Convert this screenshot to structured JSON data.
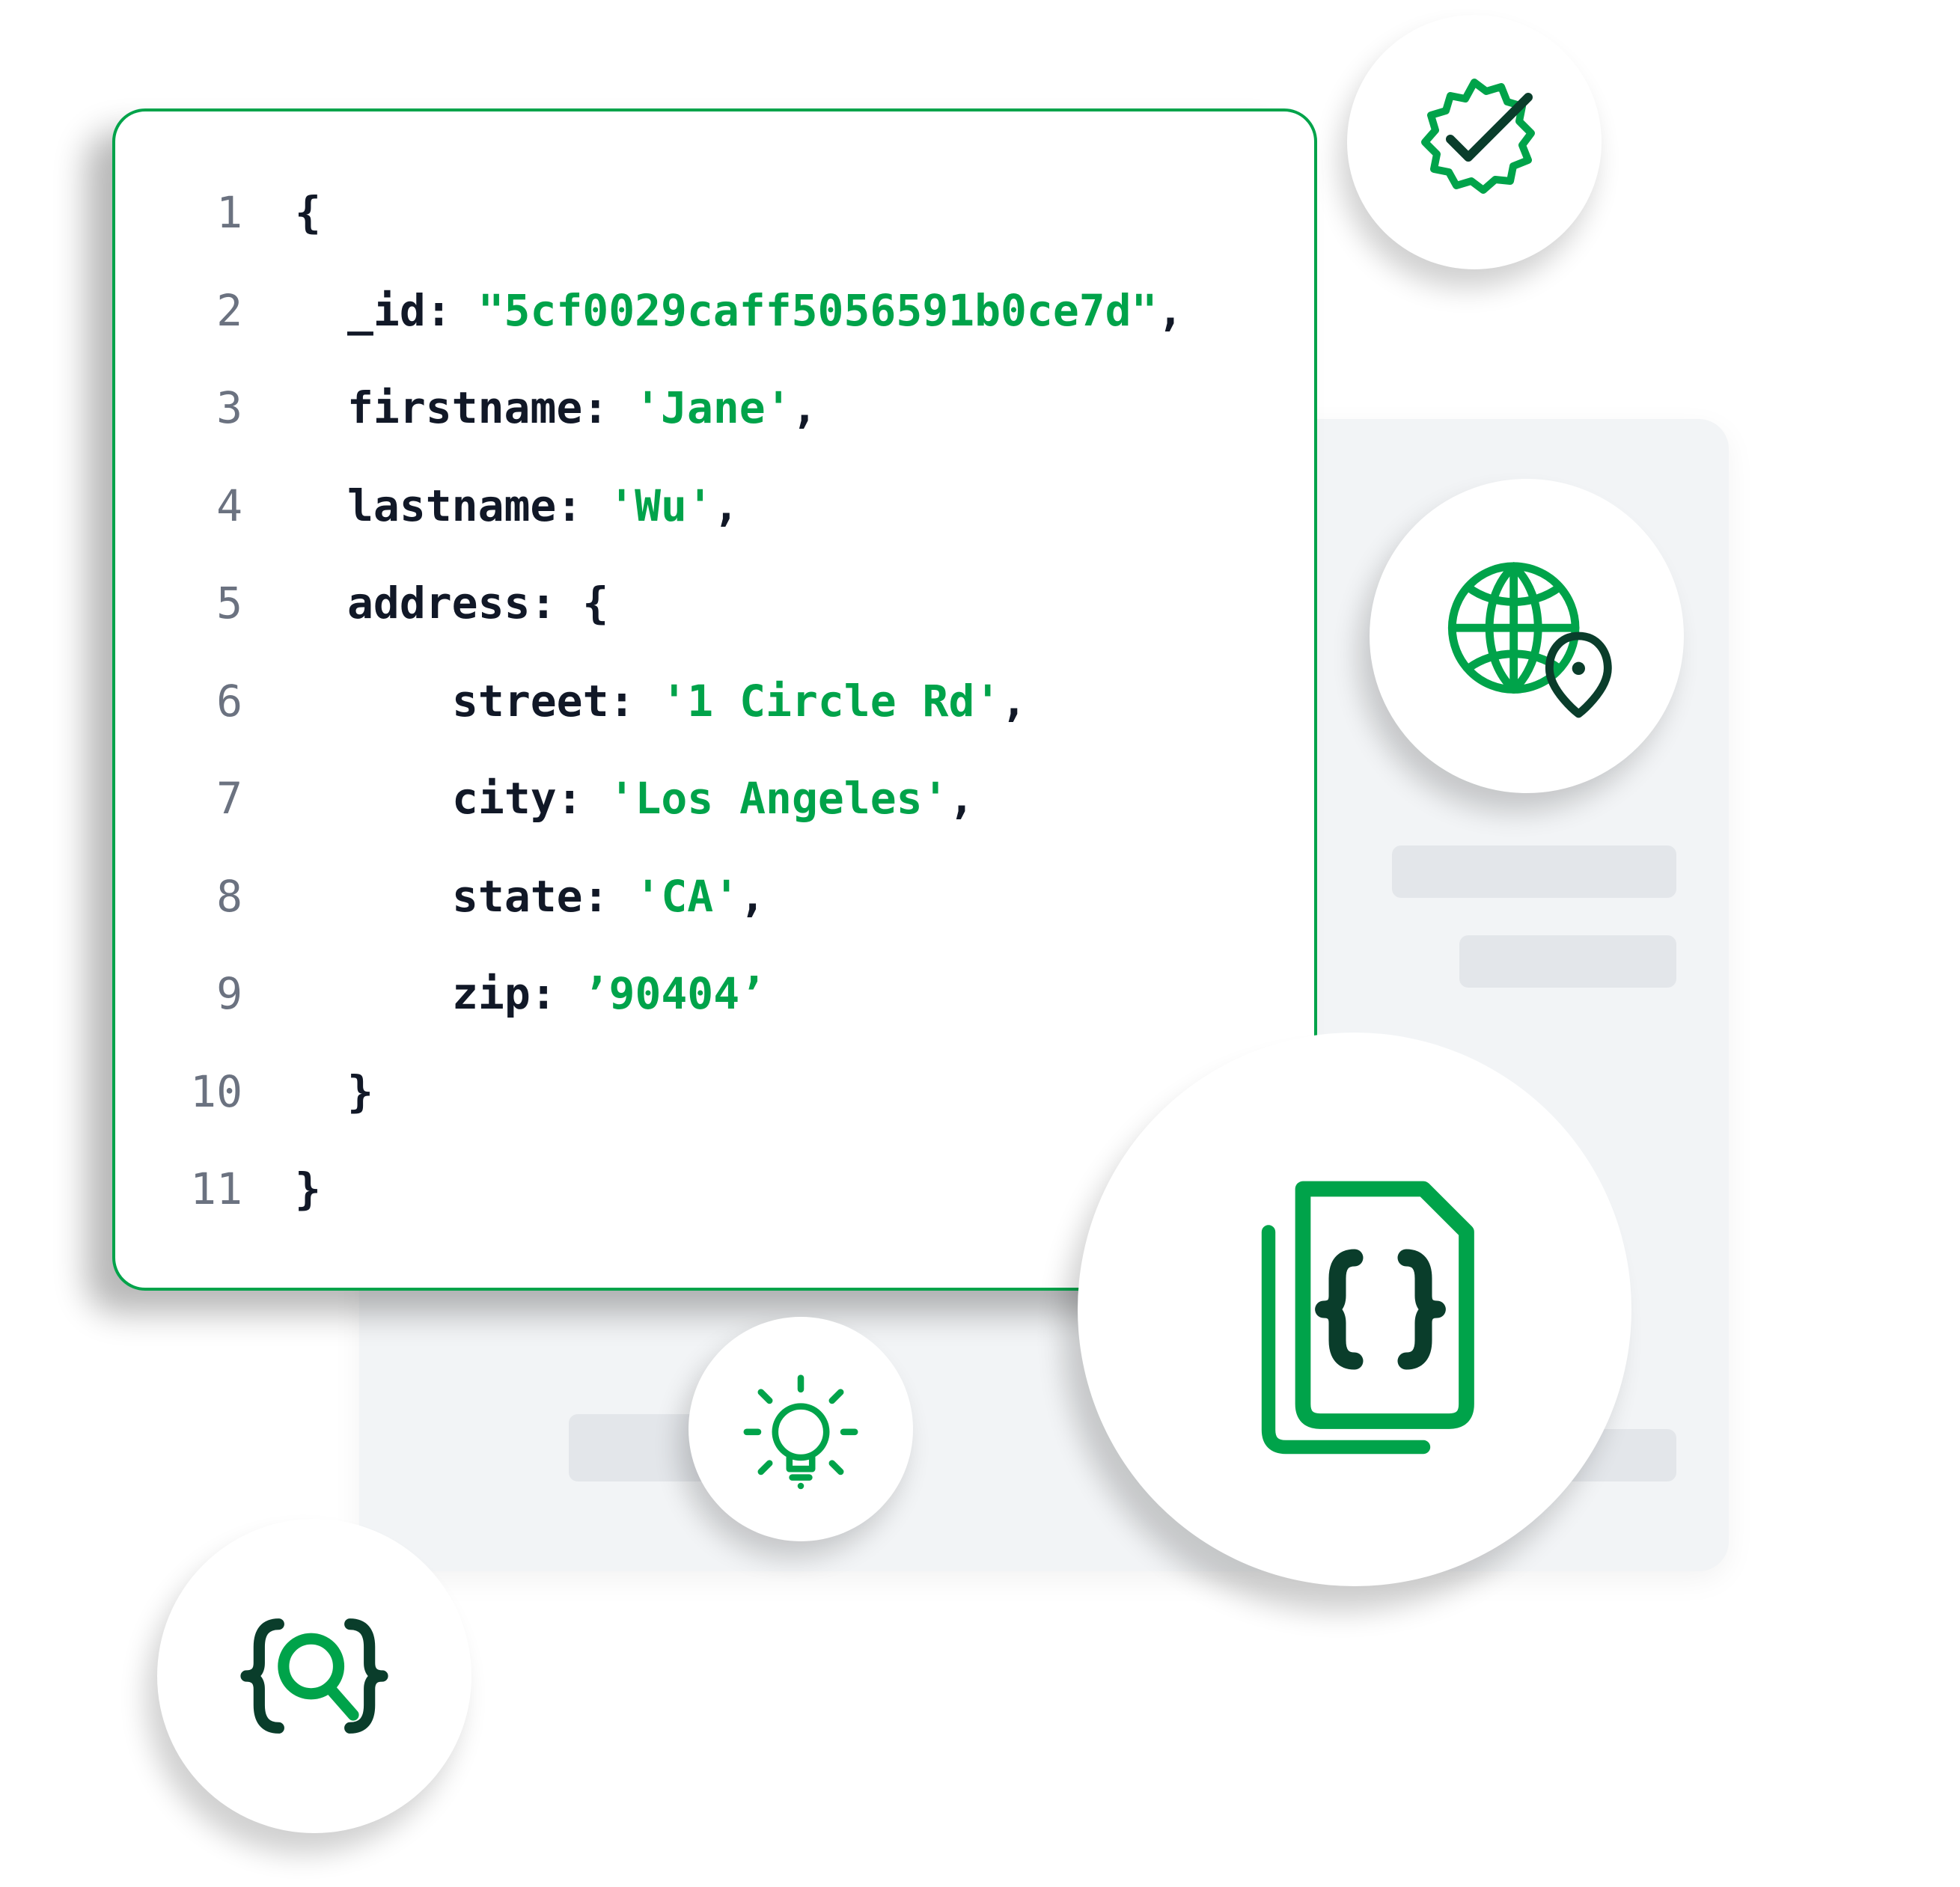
{
  "icons": {
    "check_badge": "verified-check-icon",
    "globe_pin": "globe-location-icon",
    "documents": "json-documents-icon",
    "lightbulb": "lightbulb-icon",
    "code_search": "code-search-icon"
  },
  "code": {
    "lines": [
      {
        "n": "1",
        "indent": 0,
        "segments": [
          {
            "t": "{",
            "c": "punct"
          }
        ]
      },
      {
        "n": "2",
        "indent": 1,
        "segments": [
          {
            "t": "_id",
            "c": "key"
          },
          {
            "t": ": ",
            "c": "punct"
          },
          {
            "t": "\"5cf0029caff5056591b0ce7d\"",
            "c": "dq"
          },
          {
            "t": ",",
            "c": "punct"
          }
        ]
      },
      {
        "n": "3",
        "indent": 1,
        "segments": [
          {
            "t": "firstname",
            "c": "key"
          },
          {
            "t": ": ",
            "c": "punct"
          },
          {
            "t": "'Jane'",
            "c": "str"
          },
          {
            "t": ",",
            "c": "punct"
          }
        ]
      },
      {
        "n": "4",
        "indent": 1,
        "segments": [
          {
            "t": "lastname",
            "c": "key"
          },
          {
            "t": ": ",
            "c": "punct"
          },
          {
            "t": "'Wu'",
            "c": "str"
          },
          {
            "t": ",",
            "c": "punct"
          }
        ]
      },
      {
        "n": "5",
        "indent": 1,
        "segments": [
          {
            "t": "address",
            "c": "key"
          },
          {
            "t": ": ",
            "c": "punct"
          },
          {
            "t": "{",
            "c": "punct"
          }
        ]
      },
      {
        "n": "6",
        "indent": 2,
        "segments": [
          {
            "t": "street",
            "c": "key"
          },
          {
            "t": ": ",
            "c": "punct"
          },
          {
            "t": "'1 Circle Rd'",
            "c": "str"
          },
          {
            "t": ",",
            "c": "punct"
          }
        ]
      },
      {
        "n": "7",
        "indent": 2,
        "segments": [
          {
            "t": "city",
            "c": "key"
          },
          {
            "t": ": ",
            "c": "punct"
          },
          {
            "t": "'Los Angeles'",
            "c": "str"
          },
          {
            "t": ",",
            "c": "punct"
          }
        ]
      },
      {
        "n": "8",
        "indent": 2,
        "segments": [
          {
            "t": "state",
            "c": "key"
          },
          {
            "t": ": ",
            "c": "punct"
          },
          {
            "t": "'CA'",
            "c": "str"
          },
          {
            "t": ",",
            "c": "punct"
          }
        ]
      },
      {
        "n": "9",
        "indent": 2,
        "segments": [
          {
            "t": "zip",
            "c": "key"
          },
          {
            "t": ": ",
            "c": "punct"
          },
          {
            "t": "’90404’",
            "c": "str"
          }
        ]
      },
      {
        "n": "10",
        "indent": 1,
        "segments": [
          {
            "t": "}",
            "c": "punct"
          }
        ]
      },
      {
        "n": "11",
        "indent": 0,
        "segments": [
          {
            "t": "}",
            "c": "punct"
          }
        ]
      }
    ]
  },
  "colors": {
    "accent": "#00a34a",
    "accent_dark": "#0b6e4f",
    "accent_deep": "#0a3d2b",
    "panel": "#f2f4f6"
  }
}
